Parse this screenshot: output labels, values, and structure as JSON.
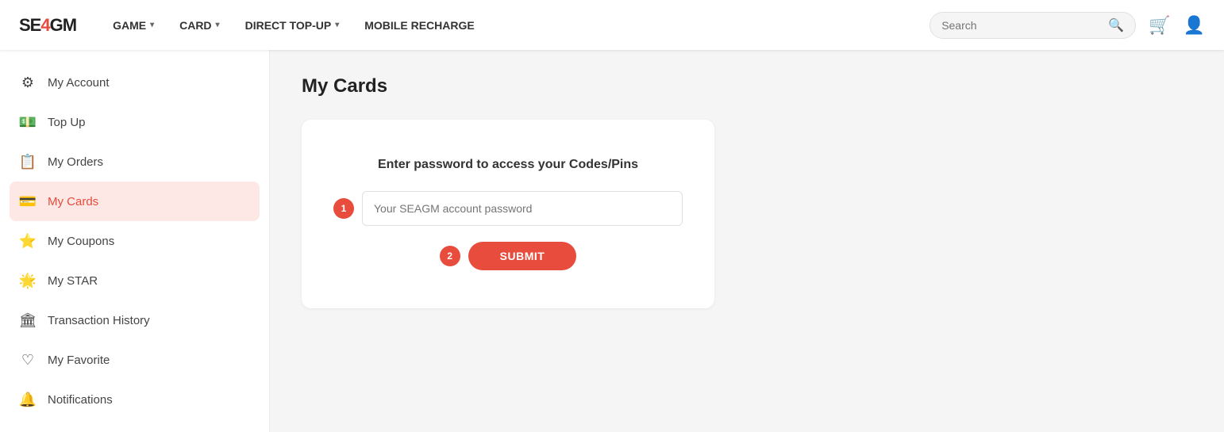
{
  "header": {
    "logo_text": "SE4GM",
    "nav": [
      {
        "label": "GAME",
        "has_dropdown": true
      },
      {
        "label": "CARD",
        "has_dropdown": true
      },
      {
        "label": "DIRECT TOP-UP",
        "has_dropdown": true
      },
      {
        "label": "MOBILE RECHARGE",
        "has_dropdown": false
      }
    ],
    "search_placeholder": "Search"
  },
  "sidebar": {
    "items": [
      {
        "id": "account",
        "label": "My Account",
        "icon": "⚙"
      },
      {
        "id": "topup",
        "label": "Top Up",
        "icon": "💵"
      },
      {
        "id": "orders",
        "label": "My Orders",
        "icon": "📋"
      },
      {
        "id": "cards",
        "label": "My Cards",
        "icon": "💳",
        "active": true
      },
      {
        "id": "coupons",
        "label": "My Coupons",
        "icon": "⭐"
      },
      {
        "id": "star",
        "label": "My STAR",
        "icon": "🌟"
      },
      {
        "id": "history",
        "label": "Transaction History",
        "icon": "🏛"
      },
      {
        "id": "favorite",
        "label": "My Favorite",
        "icon": "♡"
      },
      {
        "id": "notifications",
        "label": "Notifications",
        "icon": "🔔"
      }
    ]
  },
  "content": {
    "page_title": "My Cards",
    "panel": {
      "title": "Enter password to access your Codes/Pins",
      "input_placeholder": "Your SEAGM account password",
      "step1_badge": "1",
      "step2_badge": "2",
      "submit_label": "SUBMIT"
    }
  }
}
